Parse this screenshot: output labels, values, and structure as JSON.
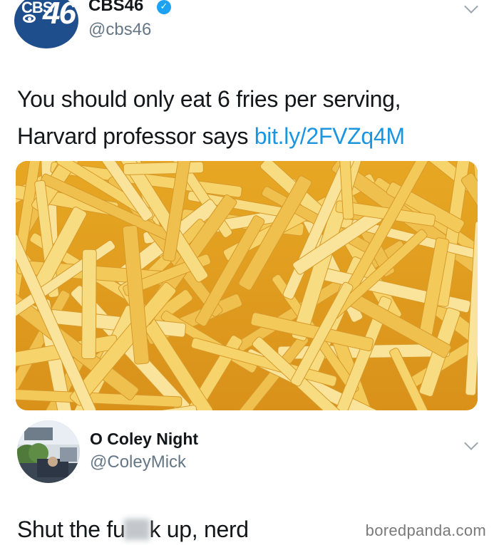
{
  "tweet1": {
    "display_name": "CBS46",
    "handle": "@cbs46",
    "avatar": {
      "logo_text": "CBS",
      "logo_number": "46",
      "icon": "cbs-eye-icon"
    },
    "verified_icon": "verified-badge-icon",
    "menu_icon": "chevron-down-icon",
    "text_line1": "You should only eat 6 fries per serving,",
    "text_line2_prefix": "Harvard professor says ",
    "link_text": "bit.ly/2FVZq4M",
    "media": {
      "subject": "french-fries-photo"
    }
  },
  "tweet2": {
    "display_name": "O Coley Night",
    "handle": "@ColeyMick",
    "menu_icon": "chevron-down-icon",
    "reply_before": "Shut the fu",
    "reply_after": "k up, nerd"
  },
  "watermark": "boredpanda.com",
  "colors": {
    "link": "#1b95e0",
    "verified": "#1da1f2",
    "cbs_blue": "#1f4e8c",
    "handle_gray": "#657786",
    "fries_gold": "#f1c24c"
  }
}
